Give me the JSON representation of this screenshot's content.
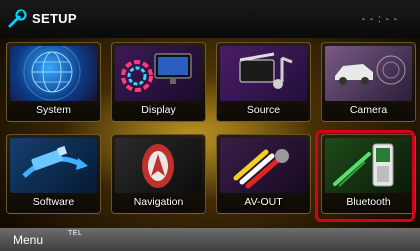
{
  "header": {
    "title": "SETUP",
    "clock": "- - : - -",
    "icon": "wrench-icon"
  },
  "tiles": [
    {
      "label": "System",
      "icon": "globe-icon"
    },
    {
      "label": "Display",
      "icon": "monitor-icon"
    },
    {
      "label": "Source",
      "icon": "film-music-icon"
    },
    {
      "label": "Camera",
      "icon": "car-camera-icon"
    },
    {
      "label": "Software",
      "icon": "usb-arrow-icon"
    },
    {
      "label": "Navigation",
      "icon": "navigation-arrow-icon"
    },
    {
      "label": "AV-OUT",
      "icon": "av-cable-icon"
    },
    {
      "label": "Bluetooth",
      "icon": "phone-bluetooth-icon"
    }
  ],
  "footer": {
    "menu_label": "Menu",
    "tel_label": "TEL"
  },
  "colors": {
    "highlight": "#d4001c",
    "accent": "#f0b020"
  }
}
